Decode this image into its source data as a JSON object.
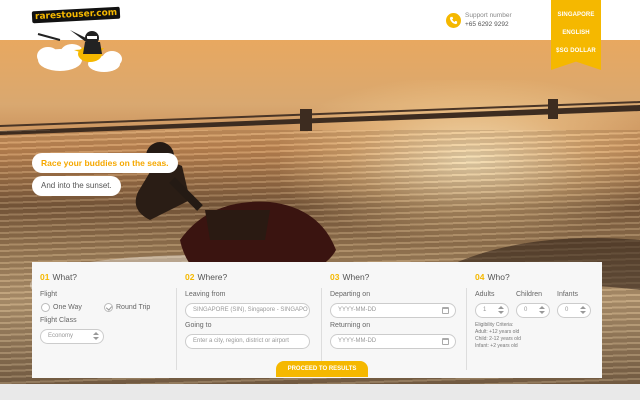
{
  "brand": {
    "logo_text": "rarestouser.com"
  },
  "support": {
    "label": "Support number",
    "number": "+65 6292 9292"
  },
  "ribbon": {
    "country": "SINGAPORE",
    "language": "ENGLISH",
    "currency": "$SG DOLLAR"
  },
  "hero": {
    "tagline": "Race your buddies on the seas.",
    "subline": "And into the sunset."
  },
  "search": {
    "what": {
      "num": "01",
      "title": "What?",
      "flight_label": "Flight",
      "one_way": "One Way",
      "round_trip": "Round Trip",
      "class_label": "Flight Class",
      "class_value": "Economy"
    },
    "where": {
      "num": "02",
      "title": "Where?",
      "leaving_label": "Leaving from",
      "leaving_value": "SINGAPORE (SIN), Singapore - SINGAPO",
      "going_label": "Going to",
      "going_placeholder": "Enter a city, region, district or airport"
    },
    "when": {
      "num": "03",
      "title": "When?",
      "departing_label": "Departing on",
      "departing_placeholder": "YYYY-MM-DD",
      "returning_label": "Returning on",
      "returning_placeholder": "YYYY-MM-DD"
    },
    "who": {
      "num": "04",
      "title": "Who?",
      "adults_label": "Adults",
      "adults_value": "1",
      "children_label": "Children",
      "children_value": "0",
      "infants_label": "Infants",
      "infants_value": "0",
      "elig_title": "Eligibility Criteria:",
      "elig_adult": "Adult: +12 years old",
      "elig_child": "Child: 2-12 years old",
      "elig_infant": "Infant: +2 years old"
    },
    "proceed_label": "PROCEED TO RESULTS"
  },
  "colors": {
    "accent": "#f5b800",
    "panel": "#f7f7f7"
  }
}
